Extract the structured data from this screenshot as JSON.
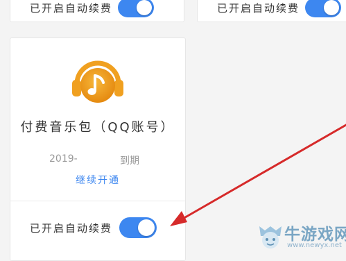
{
  "top_cards": {
    "left_toggle_label": "已开启自动续费",
    "right_toggle_label": "已开启自动续费"
  },
  "package": {
    "icon": "music-note-headphones-icon",
    "title": "付费音乐包（QQ账号）",
    "expiry_year": "2019-",
    "expiry_suffix": "到期",
    "continue_label": "继续开通",
    "auto_renew_label": "已开启自动续费",
    "auto_renew_on": true
  },
  "watermark": {
    "text": "牛游戏网",
    "url": "www.newyx.net"
  },
  "colors": {
    "toggle_on": "#3d87f0",
    "link": "#3d87f0",
    "icon_orange": "#f0a020",
    "arrow_red": "#d62a2a"
  }
}
